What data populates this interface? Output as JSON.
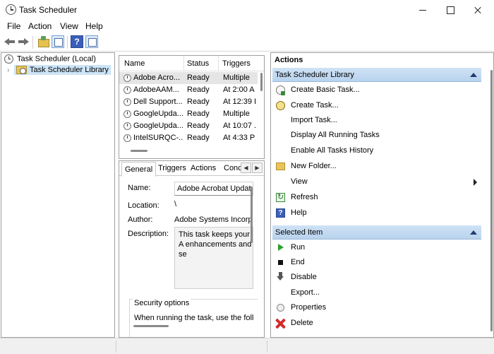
{
  "window": {
    "title": "Task Scheduler"
  },
  "menu": [
    "File",
    "Action",
    "View",
    "Help"
  ],
  "toolbar": {
    "help_glyph": "?"
  },
  "tree": {
    "root": "Task Scheduler (Local)",
    "child": "Task Scheduler Library"
  },
  "task_list": {
    "columns": [
      "Name",
      "Status",
      "Triggers"
    ],
    "rows": [
      {
        "name": "Adobe Acro...",
        "status": "Ready",
        "triggers": "Multiple"
      },
      {
        "name": "AdobeAAM...",
        "status": "Ready",
        "triggers": "At 2:00 A"
      },
      {
        "name": "Dell Support...",
        "status": "Ready",
        "triggers": "At 12:39 I"
      },
      {
        "name": "GoogleUpda...",
        "status": "Ready",
        "triggers": "Multiple"
      },
      {
        "name": "GoogleUpda...",
        "status": "Ready",
        "triggers": "At 10:07 ."
      },
      {
        "name": "IntelSURQC-...",
        "status": "Ready",
        "triggers": "At 4:33 P"
      }
    ]
  },
  "detail": {
    "tabs": [
      "General",
      "Triggers",
      "Actions",
      "Conc"
    ],
    "name_label": "Name:",
    "name_value": "Adobe Acrobat Update",
    "location_label": "Location:",
    "location_value": "\\",
    "author_label": "Author:",
    "author_value": "Adobe Systems Incorp",
    "description_label": "Description:",
    "description_value": "This task keeps your A enhancements and se",
    "security_title": "Security options",
    "security_text": "When running the task, use the follo"
  },
  "actions": {
    "title": "Actions",
    "library_section": "Task Scheduler Library",
    "library_items": [
      {
        "label": "Create Basic Task...",
        "icon": "clock-wizard-icon"
      },
      {
        "label": "Create Task...",
        "icon": "create-task-icon"
      },
      {
        "label": "Import Task...",
        "icon": ""
      },
      {
        "label": "Display All Running Tasks",
        "icon": ""
      },
      {
        "label": "Enable All Tasks History",
        "icon": ""
      },
      {
        "label": "New Folder...",
        "icon": "folder-icon"
      },
      {
        "label": "View",
        "icon": "",
        "submenu": true
      },
      {
        "label": "Refresh",
        "icon": "refresh-icon"
      },
      {
        "label": "Help",
        "icon": "help-icon"
      }
    ],
    "selected_section": "Selected Item",
    "selected_items": [
      {
        "label": "Run",
        "icon": "run-icon"
      },
      {
        "label": "End",
        "icon": "end-icon"
      },
      {
        "label": "Disable",
        "icon": "disable-icon"
      },
      {
        "label": "Export...",
        "icon": ""
      },
      {
        "label": "Properties",
        "icon": "properties-icon"
      },
      {
        "label": "Delete",
        "icon": "delete-icon"
      }
    ]
  },
  "colors": {
    "selection": "#cce4f7",
    "section_header": "#c4dbf2",
    "run_green": "#2e9e2e",
    "delete_red": "#d42a2a"
  }
}
